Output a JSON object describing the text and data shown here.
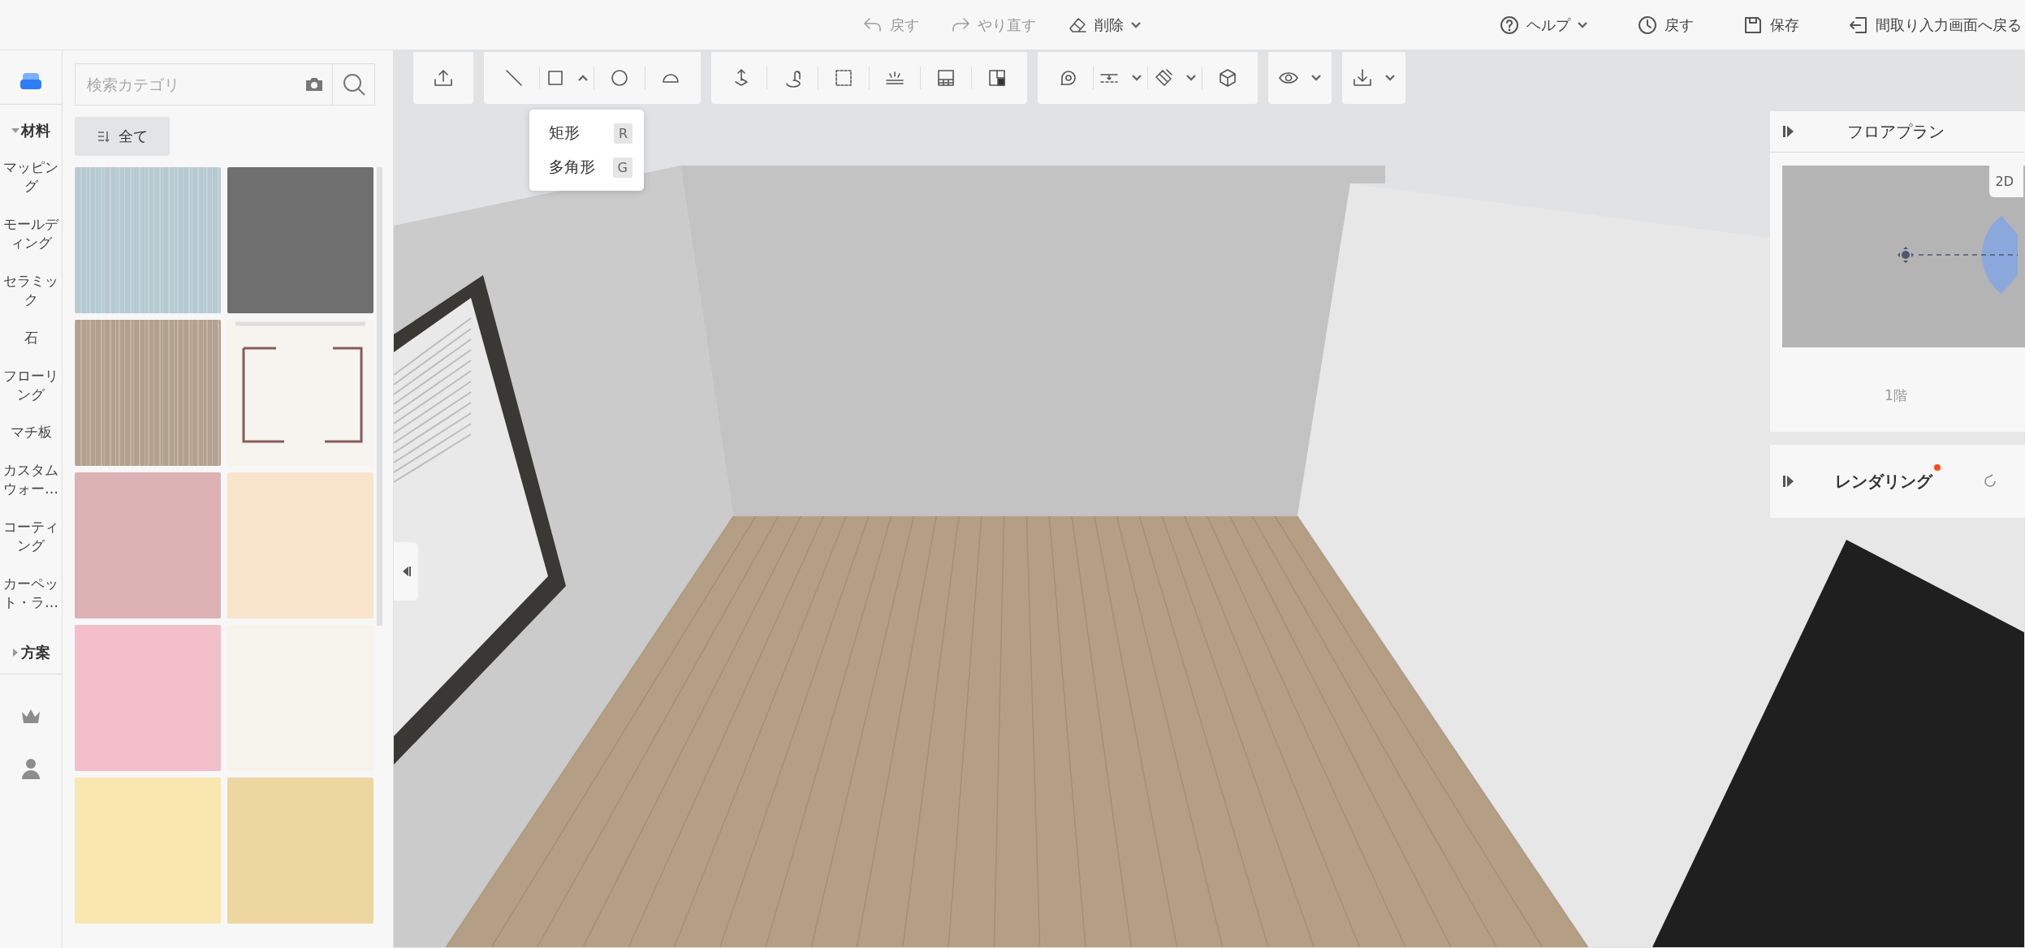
{
  "top_bar": {
    "edit_actions": [
      {
        "label": "戻す",
        "disabled": true,
        "dropdown": false
      },
      {
        "label": "やり直す",
        "disabled": true,
        "dropdown": false
      },
      {
        "label": "削除",
        "disabled": false,
        "dropdown": true
      }
    ],
    "actions": [
      {
        "label": "ヘルプ",
        "dropdown": true
      },
      {
        "label": "戻す",
        "dropdown": false
      },
      {
        "label": "保存",
        "dropdown": false
      },
      {
        "label": "間取り入力画面へ戻る",
        "dropdown": false
      }
    ]
  },
  "sidebar": {
    "sections": [
      {
        "title": "材料",
        "expanded": true,
        "items": [
          "マッピング",
          "モールディング",
          "セラミック",
          "石",
          "フローリング",
          "マチ板",
          "カスタムウォー…",
          "コーティング",
          "カーペット・ラ…"
        ]
      },
      {
        "title": "方案",
        "expanded": false
      }
    ]
  },
  "catalog": {
    "search": {
      "placeholder": "検索カテゴリ"
    },
    "filter": "全て",
    "swatches": [
      {
        "kind": "texture",
        "color": "#b7cad1"
      },
      {
        "kind": "plain",
        "color": "#6f6f6f"
      },
      {
        "kind": "texture",
        "color": "#b2a28d"
      },
      {
        "kind": "molding",
        "color": "#f6f4ee"
      },
      {
        "kind": "plain",
        "color": "#dcb2b4"
      },
      {
        "kind": "plain",
        "color": "#f9e4cc"
      },
      {
        "kind": "plain",
        "color": "#f2bfca"
      },
      {
        "kind": "plain",
        "color": "#f6f4ea"
      },
      {
        "kind": "plain",
        "color": "#f8e8b0"
      },
      {
        "kind": "plain",
        "color": "#ebd79f"
      }
    ]
  },
  "toolbar": {
    "groups": [
      {
        "tools": [
          {
            "kind": "button"
          }
        ]
      },
      {
        "tools": [
          {
            "kind": "button"
          },
          {
            "kind": "menu",
            "expanded": true
          },
          {
            "kind": "button"
          },
          {
            "kind": "button"
          }
        ]
      },
      {
        "tools": [
          {
            "kind": "button"
          },
          {
            "kind": "button"
          },
          {
            "kind": "button"
          },
          {
            "kind": "button"
          },
          {
            "kind": "button"
          },
          {
            "kind": "button"
          }
        ]
      },
      {
        "tools": [
          {
            "kind": "button"
          },
          {
            "kind": "menu",
            "expanded": false
          },
          {
            "kind": "menu",
            "expanded": false
          },
          {
            "kind": "button"
          }
        ]
      },
      {
        "tools": [
          {
            "kind": "menu",
            "expanded": false
          }
        ]
      },
      {
        "tools": [
          {
            "kind": "menu",
            "expanded": false
          }
        ]
      }
    ]
  },
  "shape_menu": {
    "items": [
      {
        "label": "矩形",
        "shortcut": "R"
      },
      {
        "label": "多角形",
        "shortcut": "G"
      }
    ]
  },
  "floor_plan": {
    "title": "フロアプラン",
    "view_tab": "2D",
    "floor": "1階"
  },
  "rendering": {
    "title": "レンダリング",
    "notification": true
  }
}
